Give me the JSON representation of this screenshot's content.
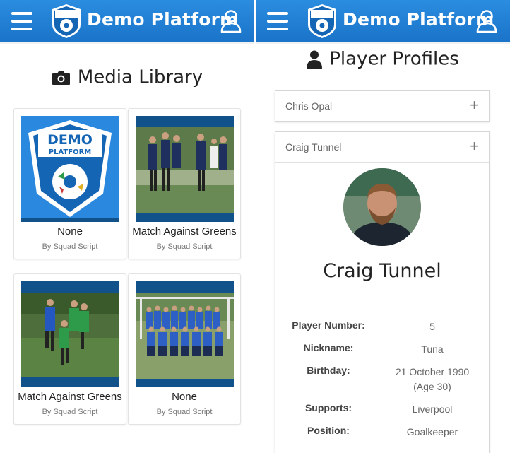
{
  "left": {
    "header": {
      "brand": "Demo Platform"
    },
    "section_title": "Media Library",
    "media": [
      {
        "caption": "None",
        "author": "By Squad Script"
      },
      {
        "caption": "Match Against Greens",
        "author": "By Squad Script"
      },
      {
        "caption": "Match Against Greens",
        "author": "By Squad Script"
      },
      {
        "caption": "None",
        "author": "By Squad Script"
      }
    ],
    "logo_text": [
      "DEMO",
      "PLATFORM"
    ]
  },
  "right": {
    "header": {
      "brand": "Demo Platform"
    },
    "section_title": "Player Profiles",
    "players": [
      {
        "name": "Chris Opal",
        "expanded": false
      },
      {
        "name": "Craig Tunnel",
        "expanded": true
      }
    ],
    "profile": {
      "name": "Craig Tunnel",
      "details": [
        {
          "label": "Player Number:",
          "value": "5"
        },
        {
          "label": "Nickname:",
          "value": "Tuna"
        },
        {
          "label": "Birthday:",
          "value": "21 October 1990",
          "extra": "(Age 30)"
        },
        {
          "label": "Supports:",
          "value": "Liverpool"
        },
        {
          "label": "Position:",
          "value": "Goalkeeper"
        }
      ]
    }
  },
  "icons": {
    "menu": "hamburger-icon",
    "user": "user-icon",
    "camera": "camera-icon",
    "person": "person-icon",
    "expand": "plus-icon"
  },
  "colors": {
    "header": "#1f7dd4",
    "badge_blue": "#1565b5",
    "text_dark": "#222222",
    "text_muted": "#777777"
  }
}
